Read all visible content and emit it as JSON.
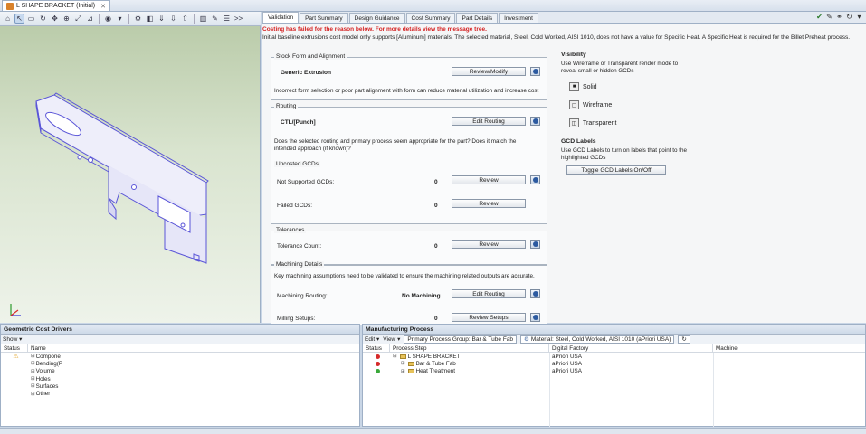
{
  "title_tab": {
    "label": "L SHAPE BRACKET (Initial)"
  },
  "viewer_toolbar": {
    "more_label": ">>"
  },
  "tabs": [
    "Validation",
    "Part Summary",
    "Design Guidance",
    "Cost Summary",
    "Part Details",
    "Investment"
  ],
  "alerts": {
    "error": "Costing has failed for the reason below. For more details view the message tree.",
    "message": "Initial baseline extrusions cost model only supports [Aluminum] materials. The selected material, Steel, Cold Worked, AISI 1010, does not have a value for Specific Heat. A Specific Heat is required for the Billet Preheat process."
  },
  "stock": {
    "title": "Stock Form and Alignment",
    "value": "Generic Extrusion",
    "button": "Review/Modify",
    "note": "Incorrect form selection or poor part alignment with form can reduce material utilization and increase cost"
  },
  "routing": {
    "title": "Routing",
    "value": "CTL/[Punch]",
    "button": "Edit Routing",
    "note": "Does the selected routing and primary process seem appropriate for the part? Does it match the intended approach (if known)?"
  },
  "uncosted": {
    "title": "Uncosted GCDs",
    "rows": [
      {
        "label": "Not Supported GCDs:",
        "count": "0",
        "button": "Review"
      },
      {
        "label": "Failed GCDs:",
        "count": "0",
        "button": "Review"
      }
    ]
  },
  "tolerances": {
    "title": "Tolerances",
    "label": "Tolerance Count:",
    "count": "0",
    "button": "Review"
  },
  "machining": {
    "title": "Machining Details",
    "note": "Key machining assumptions need to be validated to ensure the machining related outputs are accurate.",
    "rows": [
      {
        "label": "Machining Routing:",
        "value": "No Machining",
        "button": "Edit Routing"
      },
      {
        "label": "Milling Setups:",
        "value": "0",
        "button": "Review Setups"
      }
    ]
  },
  "visibility": {
    "title": "Visibility",
    "desc": "Use Wireframe or Transparent render mode to reveal small or hidden GCDs",
    "options": [
      "Solid",
      "Wireframe",
      "Transparent"
    ],
    "gcd_title": "GCD Labels",
    "gcd_desc": "Use GCD Labels to turn on labels that point to the highlighted GCDs",
    "gcd_button": "Toggle GCD Labels On/Off"
  },
  "cost_drivers": {
    "title": "Geometric Cost Drivers",
    "show_label": "Show",
    "columns": [
      "Status",
      "Name"
    ],
    "rows": [
      "Compone",
      "Bending(P",
      "Volume",
      "Holes",
      "Surfaces",
      "Other"
    ]
  },
  "manufacturing": {
    "title": "Manufacturing Process",
    "edit_label": "Edit",
    "view_label": "View",
    "group_label": "Primary Process Group: Bar & Tube Fab",
    "material_label": "Material: Steel, Cold Worked, AISI 1010 (aPriori USA)",
    "columns": [
      "Status",
      "Process Step",
      "Digital Factory",
      "Machine"
    ],
    "rows": [
      {
        "step": "L SHAPE BRACKET",
        "factory": "aPriori USA",
        "status_color": "#d62a2a"
      },
      {
        "step": "Bar & Tube Fab",
        "factory": "aPriori USA",
        "status_color": "#d62a2a"
      },
      {
        "step": "Heat Treatment",
        "factory": "aPriori USA",
        "status_color": "#3aa83a"
      }
    ]
  }
}
